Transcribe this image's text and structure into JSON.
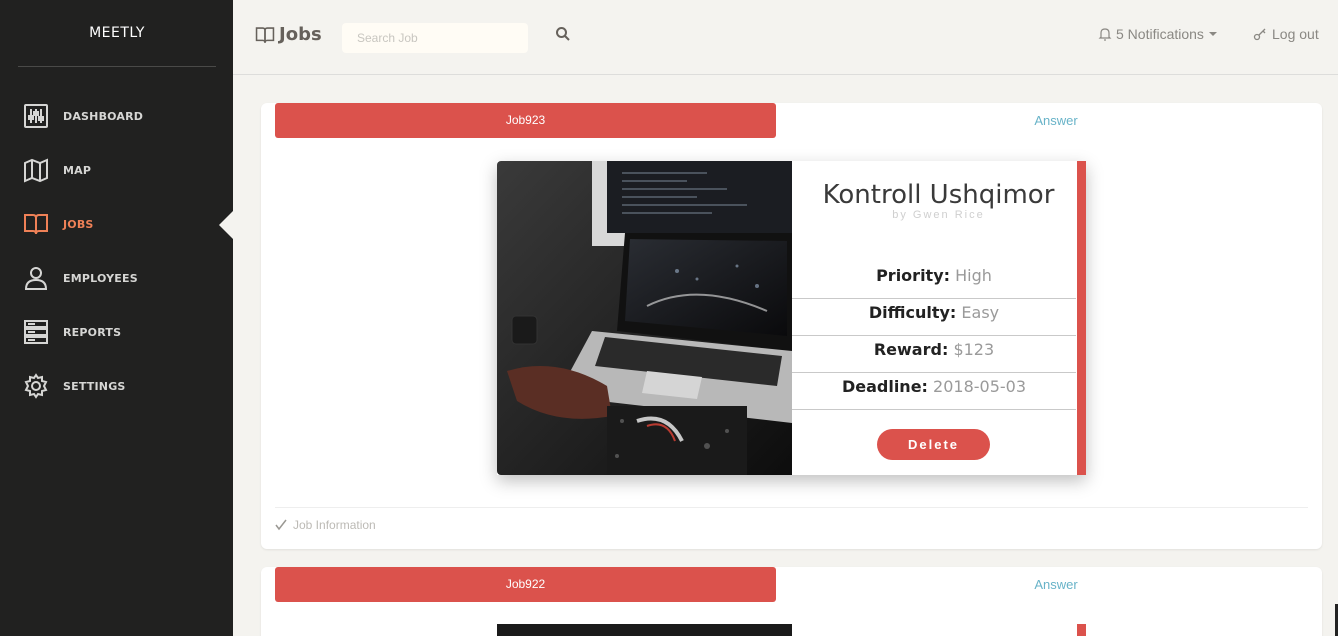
{
  "sidebar": {
    "brand": "MEETLY",
    "items": [
      {
        "label": "DASHBOARD",
        "icon": "dashboard-sliders-icon"
      },
      {
        "label": "MAP",
        "icon": "map-icon"
      },
      {
        "label": "JOBS",
        "icon": "book-icon",
        "active": true
      },
      {
        "label": "EMPLOYEES",
        "icon": "user-icon"
      },
      {
        "label": "REPORTS",
        "icon": "server-icon"
      },
      {
        "label": "SETTINGS",
        "icon": "gear-icon"
      }
    ],
    "active_color": "#ef8157"
  },
  "header": {
    "title": "Jobs",
    "search": {
      "placeholder": "Search Job",
      "value": ""
    },
    "notifications": "5 Notifications",
    "logout": "Log out"
  },
  "jobs": [
    {
      "tab": "Job923",
      "answer_tab": "Answer",
      "title": "Kontroll Ushqimor",
      "author": "by Gwen Rice",
      "priority_label": "Priority:",
      "priority": "High",
      "difficulty_label": "Difficulty:",
      "difficulty": "Easy",
      "reward_label": "Reward:",
      "reward": "$123",
      "deadline_label": "Deadline:",
      "deadline": "2018-05-03",
      "delete_label": "Delete",
      "footer": "Job Information"
    },
    {
      "tab": "Job922",
      "answer_tab": "Answer"
    }
  ],
  "colors": {
    "accent_red": "#db524c",
    "link_blue": "#68b3c8",
    "sidebar_bg": "#212120"
  }
}
